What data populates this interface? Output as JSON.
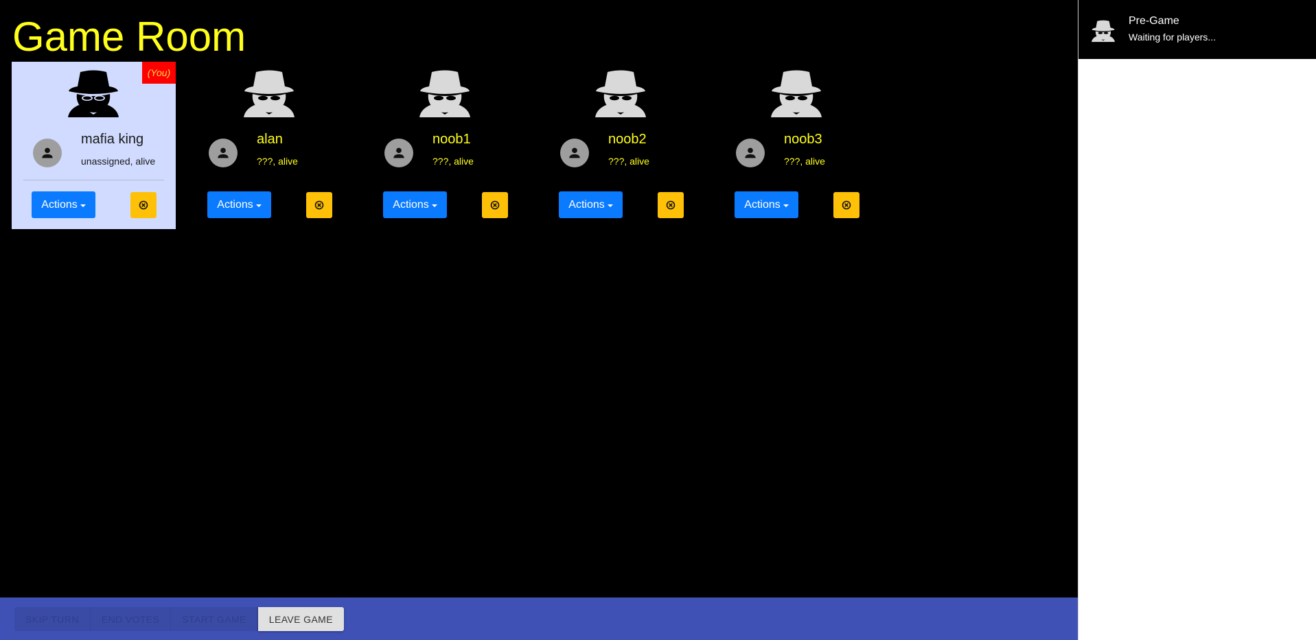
{
  "header": {
    "title": "Game Room"
  },
  "players": [
    {
      "name": "mafia king",
      "status": "unassigned, alive",
      "is_you": true,
      "you_label": "(You)",
      "actions_label": "Actions"
    },
    {
      "name": "alan",
      "status": "???, alive",
      "is_you": false,
      "actions_label": "Actions"
    },
    {
      "name": "noob1",
      "status": "???, alive",
      "is_you": false,
      "actions_label": "Actions"
    },
    {
      "name": "noob2",
      "status": "???, alive",
      "is_you": false,
      "actions_label": "Actions"
    },
    {
      "name": "noob3",
      "status": "???, alive",
      "is_you": false,
      "actions_label": "Actions"
    }
  ],
  "bottom_bar": {
    "skip_turn": "SKIP TURN",
    "end_votes": "END VOTES",
    "start_game": "START GAME",
    "leave_game": "LEAVE GAME"
  },
  "sidebar": {
    "phase": "Pre-Game",
    "phase_detail": "Waiting for players..."
  },
  "icons": {
    "spy": "spy-icon",
    "avatar": "person-icon",
    "kick": "close-circle-icon"
  },
  "colors": {
    "title": "#ffff1a",
    "you_card": "#d0dbff",
    "you_badge": "#ff0000",
    "actions_button": "#0a7bff",
    "kick_button": "#ffc107",
    "bottom_bar": "#3f51b5"
  }
}
